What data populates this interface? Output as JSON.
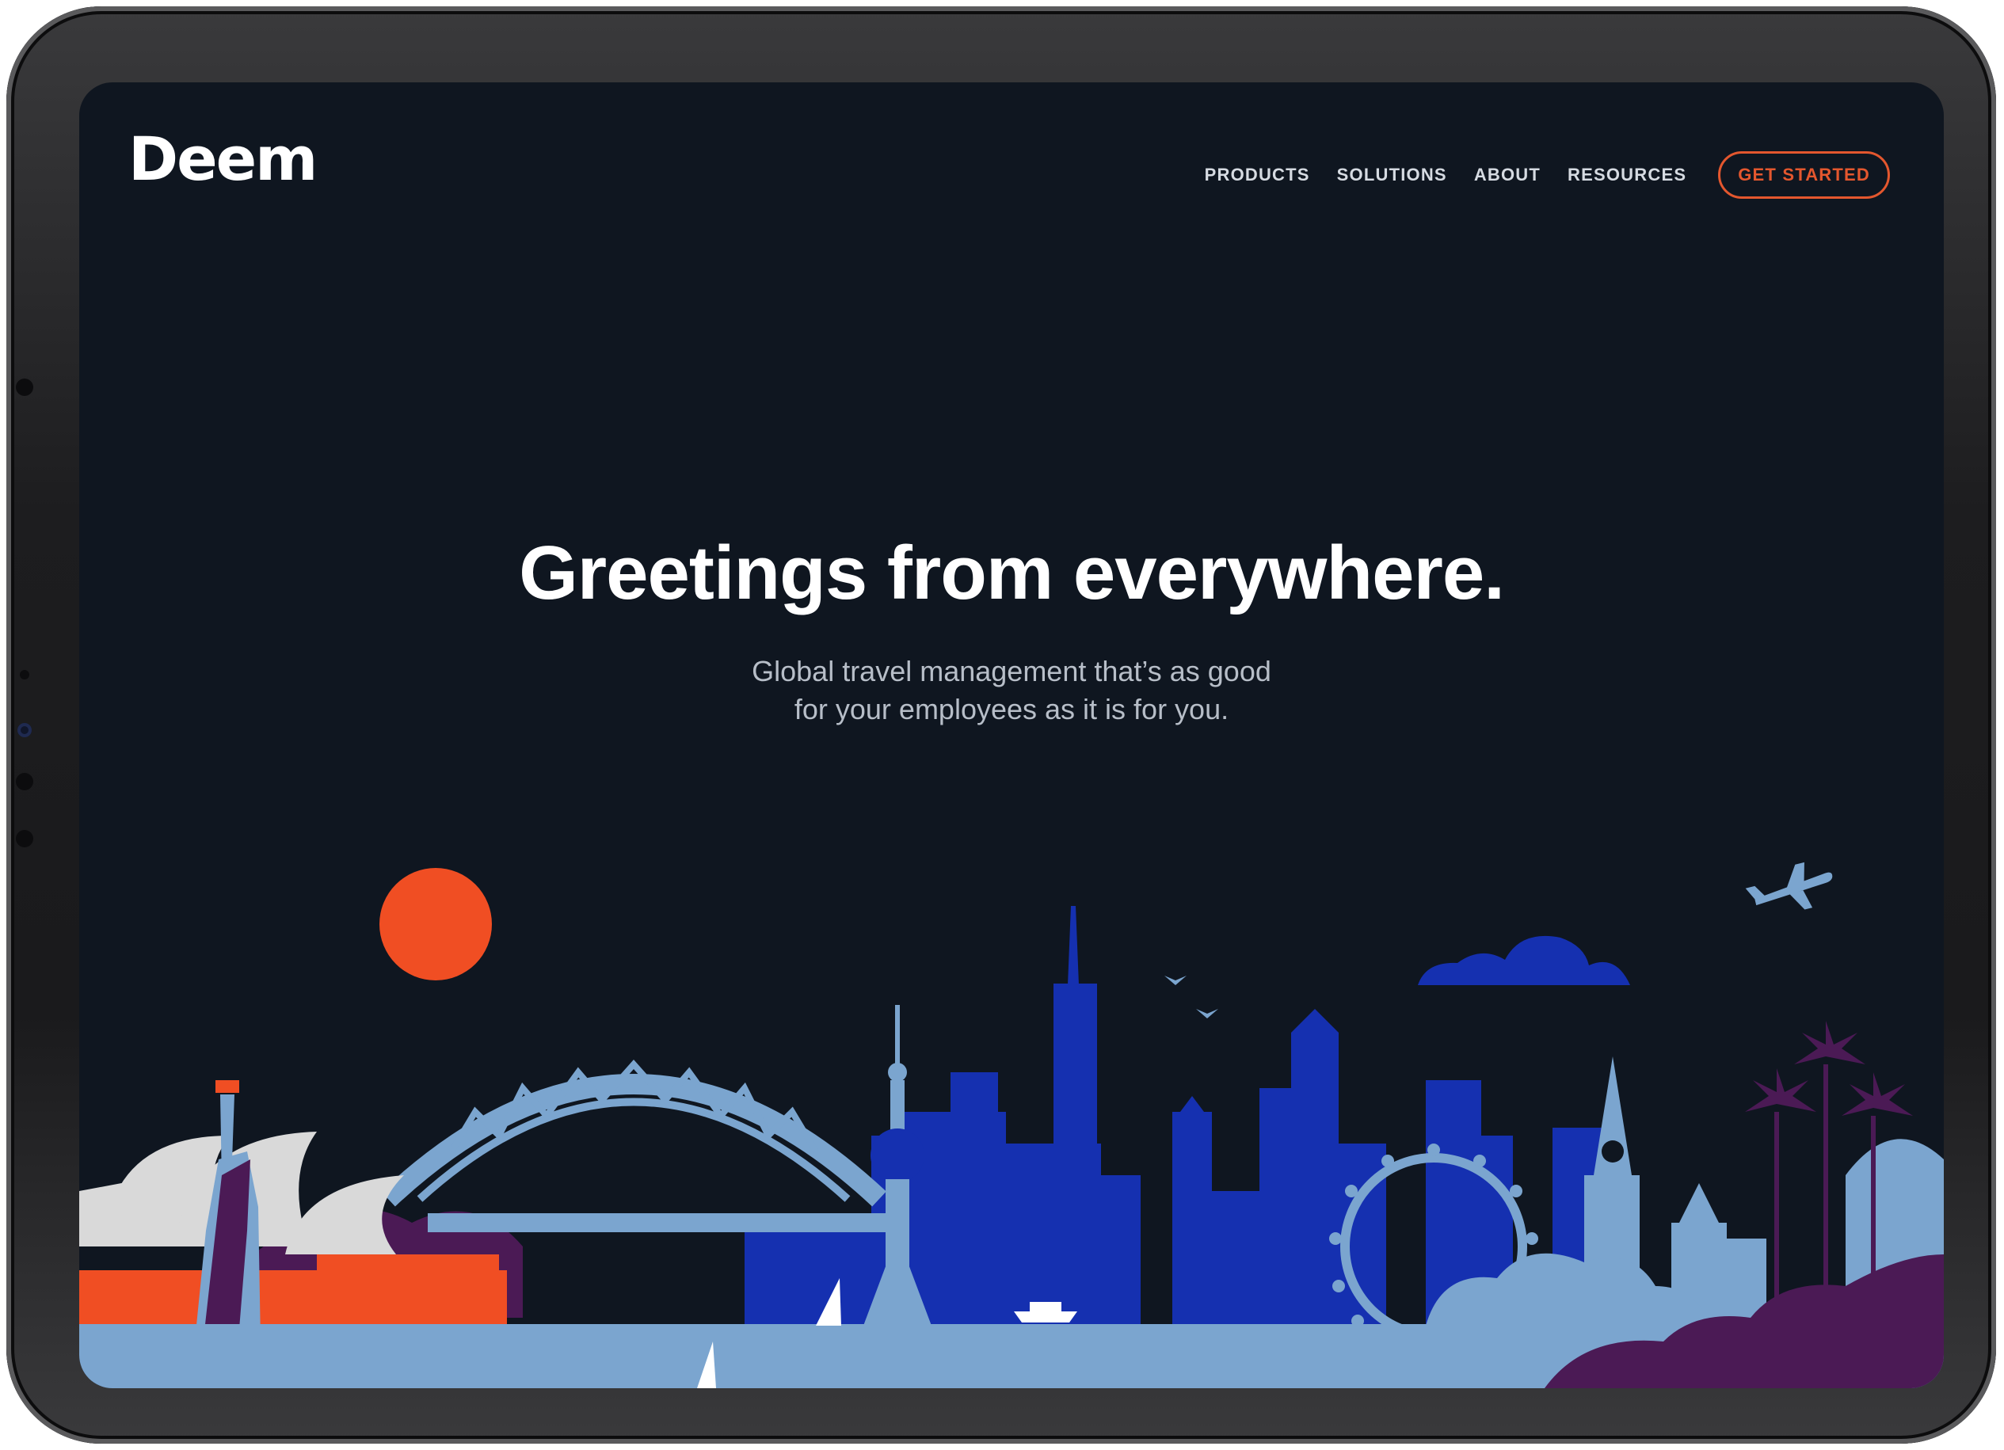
{
  "header": {
    "logo_text": "Deem",
    "nav": [
      {
        "label": "PRODUCTS"
      },
      {
        "label": "SOLUTIONS"
      },
      {
        "label": "ABOUT"
      },
      {
        "label": "RESOURCES"
      }
    ],
    "cta_label": "GET STARTED"
  },
  "hero": {
    "title": "Greetings from everywhere.",
    "subtitle_line1": "Global travel management that’s as good",
    "subtitle_line2": "for your employees as it is for you."
  },
  "colors": {
    "background": "#0f1620",
    "accent": "#e4572e",
    "royal_blue": "#1530b0",
    "light_blue": "#7ba5cf",
    "purple": "#4b1a55"
  },
  "illustration": {
    "icons": [
      "sun-icon",
      "airplane-icon",
      "cloud-icon",
      "bird-icon",
      "palm-tree-icon",
      "ferris-wheel-icon",
      "bridge-icon",
      "statue-of-liberty-icon",
      "opera-house-icon",
      "tower-icon",
      "sailboat-icon",
      "ship-icon"
    ]
  }
}
